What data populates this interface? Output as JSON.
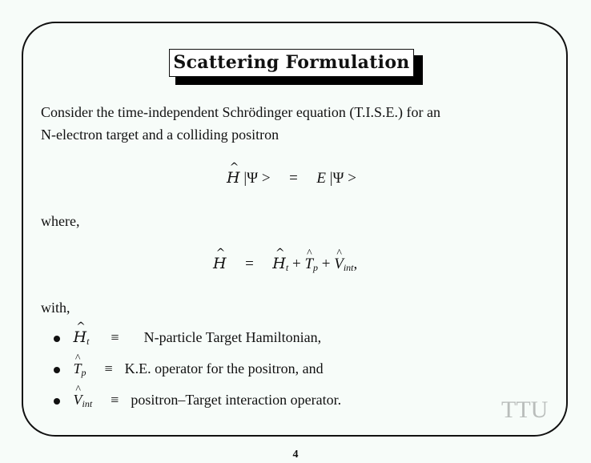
{
  "slide": {
    "title": "Scattering Formulation",
    "intro_line1": "Consider the time-independent Schrödinger equation (T.I.S.E.) for an",
    "intro_line2": "N-electron target and a colliding positron",
    "equation1": {
      "lhs_op": "H",
      "ket": "|Ψ >",
      "equals": "=",
      "energy": "E",
      "rhs_ket": "|Ψ >"
    },
    "where_label": "where,",
    "equation2": {
      "lhs": "H",
      "equals": "=",
      "term1": "H",
      "term1_sub": "t",
      "plus1": "+",
      "term2": "T",
      "term2_sub": "p",
      "plus2": "+",
      "term3": "V",
      "term3_sub": "int",
      "tail": ","
    },
    "with_label": "with,",
    "bullets": [
      {
        "symbol": "H",
        "sub": "t",
        "equiv": "≡",
        "text": "N-particle Target Hamiltonian,"
      },
      {
        "symbol": "T",
        "sub": "p",
        "equiv": "≡",
        "text": "K.E. operator for the positron, and"
      },
      {
        "symbol": "V",
        "sub": "int",
        "equiv": "≡",
        "text": "positron–Target interaction operator."
      }
    ],
    "watermark": "TTU",
    "page_number": "4"
  }
}
